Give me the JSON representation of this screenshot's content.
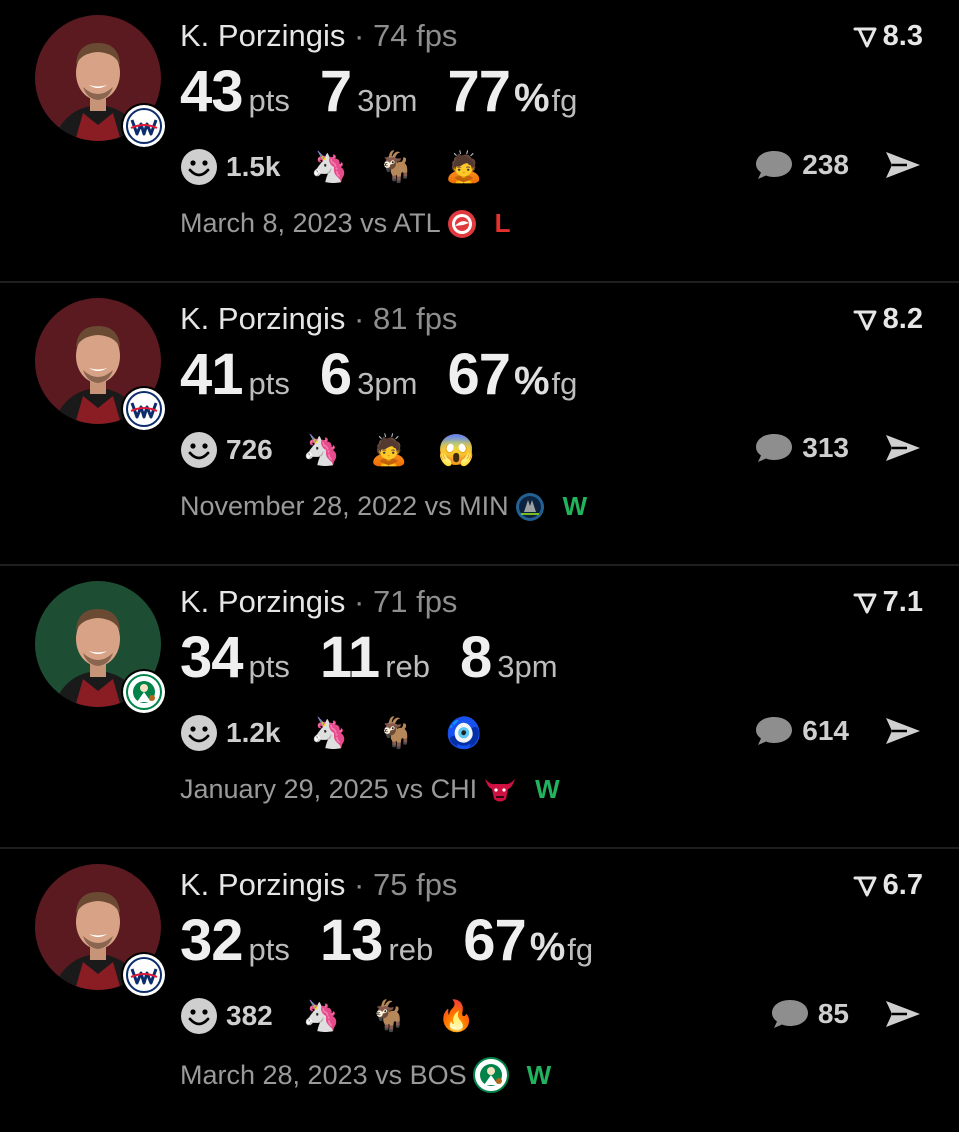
{
  "colors": {
    "loss": "#e5312e",
    "win": "#22b35f"
  },
  "cards": [
    {
      "player": "K. Porzingis",
      "separator": "·",
      "fps": "74 fps",
      "rating": "8.3",
      "avatar_bg": "#5a1a20",
      "team_icon": "wizards-logo-icon",
      "stats": [
        {
          "num": "43",
          "unit": "pts"
        },
        {
          "num": "7",
          "unit": "3pm"
        },
        {
          "num": "77",
          "pct": "%",
          "unit": "fg"
        }
      ],
      "reaction_count": "1.5k",
      "reaction_emojis": [
        "🦄",
        "🐐",
        "🙇"
      ],
      "comments": "238",
      "date": "March 8, 2023 vs ATL",
      "opponent_icon": "hawks-logo-icon",
      "result": "L"
    },
    {
      "player": "K. Porzingis",
      "separator": "·",
      "fps": "81 fps",
      "rating": "8.2",
      "avatar_bg": "#5a1a20",
      "team_icon": "wizards-logo-icon",
      "stats": [
        {
          "num": "41",
          "unit": "pts"
        },
        {
          "num": "6",
          "unit": "3pm"
        },
        {
          "num": "67",
          "pct": "%",
          "unit": "fg"
        }
      ],
      "reaction_count": "726",
      "reaction_emojis": [
        "🦄",
        "🙇",
        "😱"
      ],
      "comments": "313",
      "date": "November 28, 2022 vs MIN",
      "opponent_icon": "timberwolves-logo-icon",
      "result": "W"
    },
    {
      "player": "K. Porzingis",
      "separator": "·",
      "fps": "71 fps",
      "rating": "7.1",
      "avatar_bg": "#1d4d33",
      "team_icon": "celtics-logo-icon",
      "stats": [
        {
          "num": "34",
          "unit": "pts"
        },
        {
          "num": "11",
          "unit": "reb"
        },
        {
          "num": "8",
          "unit": "3pm"
        }
      ],
      "reaction_count": "1.2k",
      "reaction_emojis": [
        "🦄",
        "🐐",
        "🧿"
      ],
      "comments": "614",
      "date": "January 29, 2025 vs CHI",
      "opponent_icon": "bulls-logo-icon",
      "result": "W"
    },
    {
      "player": "K. Porzingis",
      "separator": "·",
      "fps": "75 fps",
      "rating": "6.7",
      "avatar_bg": "#5a1a20",
      "team_icon": "wizards-logo-icon",
      "stats": [
        {
          "num": "32",
          "unit": "pts"
        },
        {
          "num": "13",
          "unit": "reb"
        },
        {
          "num": "67",
          "pct": "%",
          "unit": "fg"
        }
      ],
      "reaction_count": "382",
      "reaction_emojis": [
        "🦄",
        "🐐",
        "🔥"
      ],
      "comments": "85",
      "date": "March 28, 2023 vs BOS",
      "opponent_icon": "celtics-logo-icon",
      "result": "W"
    }
  ]
}
